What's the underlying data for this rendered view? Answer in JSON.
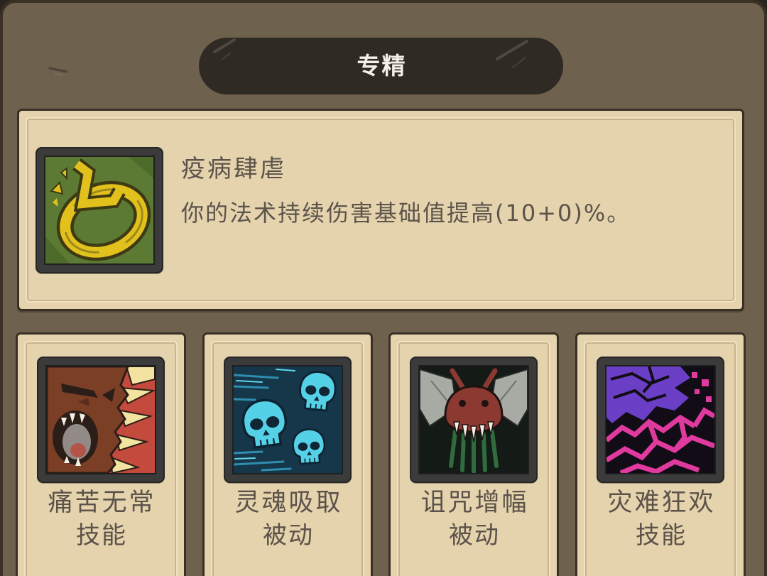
{
  "header": {
    "title": "专精"
  },
  "featured": {
    "name": "疫病肆虐",
    "description": "你的法术持续伤害基础值提高(10+0)%。",
    "icon": "plague-swirl-icon"
  },
  "skills": [
    {
      "name": "痛苦无常",
      "type": "技能",
      "icon": "screaming-beast-icon"
    },
    {
      "name": "灵魂吸取",
      "type": "被动",
      "icon": "cyan-skulls-icon"
    },
    {
      "name": "诅咒增幅",
      "type": "被动",
      "icon": "cursed-fly-icon"
    },
    {
      "name": "灾难狂欢",
      "type": "技能",
      "icon": "chaos-pattern-icon"
    }
  ],
  "colors": {
    "panel": "#6e614e",
    "banner": "#2f2a23",
    "parchment": "#e5d3ad",
    "card_border": "#3a2f25",
    "text": "#5c544b",
    "banner_text": "#f4f0e8"
  }
}
